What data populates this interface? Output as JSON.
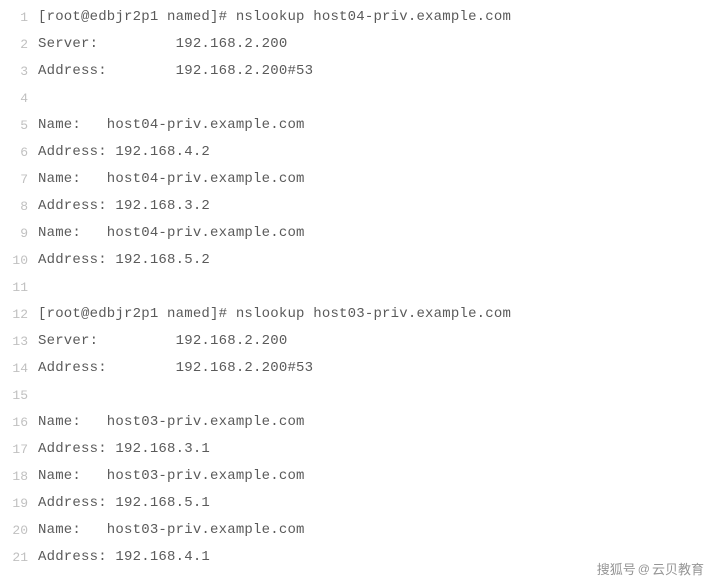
{
  "lines": [
    "[root@edbjr2p1 named]# nslookup host04-priv.example.com",
    "Server:         192.168.2.200",
    "Address:        192.168.2.200#53",
    "",
    "Name:   host04-priv.example.com",
    "Address: 192.168.4.2",
    "Name:   host04-priv.example.com",
    "Address: 192.168.3.2",
    "Name:   host04-priv.example.com",
    "Address: 192.168.5.2",
    "",
    "[root@edbjr2p1 named]# nslookup host03-priv.example.com",
    "Server:         192.168.2.200",
    "Address:        192.168.2.200#53",
    "",
    "Name:   host03-priv.example.com",
    "Address: 192.168.3.1",
    "Name:   host03-priv.example.com",
    "Address: 192.168.5.1",
    "Name:   host03-priv.example.com",
    "Address: 192.168.4.1"
  ],
  "watermark": {
    "left": "搜狐号",
    "at": "@",
    "right": "云贝教育"
  }
}
